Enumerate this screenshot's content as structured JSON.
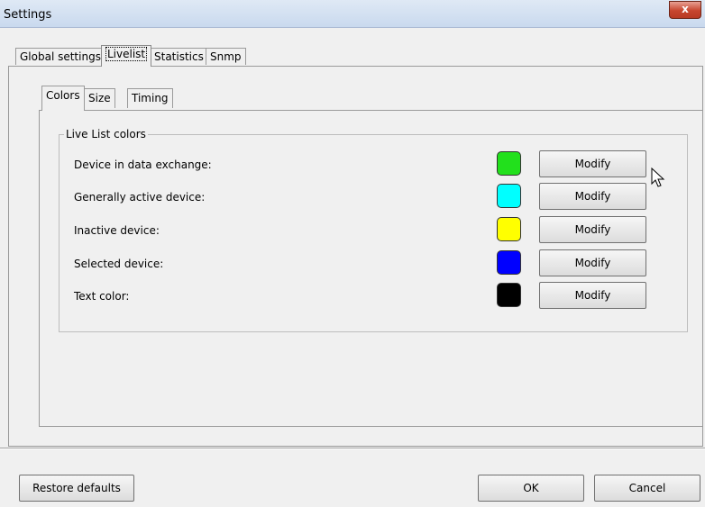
{
  "window": {
    "title": "Settings",
    "close_glyph": "x"
  },
  "tabs": [
    {
      "label": "Global settings"
    },
    {
      "label": "Livelist"
    },
    {
      "label": "Statistics"
    },
    {
      "label": "Snmp"
    }
  ],
  "active_tab": "Livelist",
  "subtabs": [
    {
      "label": "Colors"
    },
    {
      "label": "Size"
    },
    {
      "label": "Timing"
    }
  ],
  "active_subtab": "Colors",
  "group": {
    "legend": "Live List colors",
    "rows": [
      {
        "label": "Device in data exchange:",
        "color": "#22e01c",
        "button": "Modify"
      },
      {
        "label": "Generally active device:",
        "color": "#00ffff",
        "button": "Modify"
      },
      {
        "label": "Inactive device:",
        "color": "#ffff00",
        "button": "Modify"
      },
      {
        "label": "Selected device:",
        "color": "#0000ff",
        "button": "Modify"
      },
      {
        "label": "Text color:",
        "color": "#000000",
        "button": "Modify"
      }
    ]
  },
  "footer": {
    "restore": "Restore defaults",
    "ok": "OK",
    "cancel": "Cancel"
  }
}
